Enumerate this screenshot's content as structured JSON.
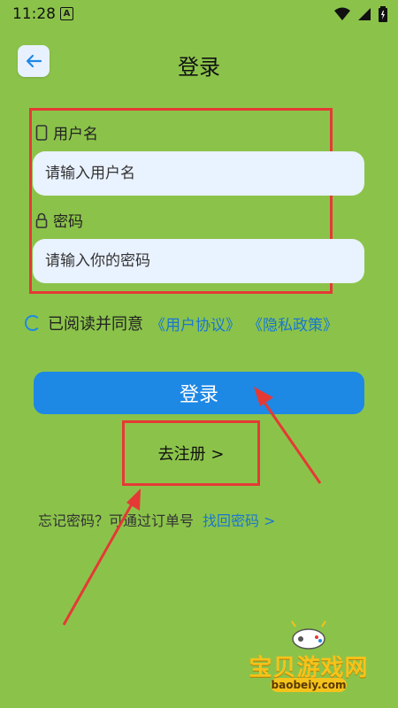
{
  "status_bar": {
    "time": "11:28",
    "notification_letter": "A"
  },
  "header": {
    "title": "登录"
  },
  "form": {
    "username_label": "用户名",
    "username_placeholder": "请输入用户名",
    "password_label": "密码",
    "password_placeholder": "请输入你的密码"
  },
  "agreement": {
    "text": "已阅读并同意",
    "user_agreement": "《用户协议》",
    "privacy_policy": "《隐私政策》"
  },
  "login_button": "登录",
  "register_link": "去注册 >",
  "forgot": {
    "text": "忘记密码？可通过订单号",
    "link": "找回密码 >"
  },
  "watermark": {
    "name": "宝贝游戏网",
    "url": "baobeiy.com"
  },
  "colors": {
    "background": "#8bc34a",
    "primary": "#1e88e5",
    "link": "#1976d2",
    "annotation": "#e53935"
  }
}
